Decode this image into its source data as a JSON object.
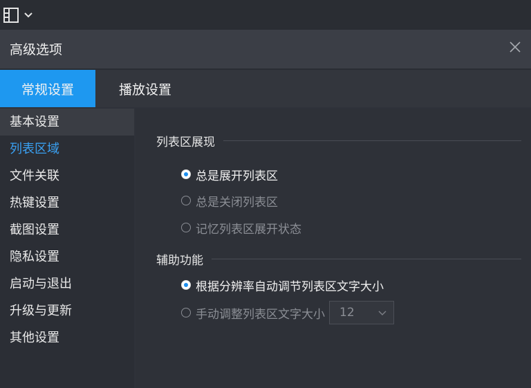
{
  "icons": {
    "menu": "menu-grid-icon",
    "dropdown": "chevron-down-icon",
    "close": "close-icon",
    "select_arrow": "chevron-down-icon"
  },
  "colors": {
    "accent": "#1e98f0",
    "active_sidebar_text": "#3aa1f3",
    "disabled_text": "#8b8e95"
  },
  "dialog": {
    "title": "高级选项",
    "tabs": [
      {
        "label": "常规设置",
        "active": true
      },
      {
        "label": "播放设置",
        "active": false
      }
    ]
  },
  "sidebar": {
    "items": [
      {
        "label": "基本设置"
      },
      {
        "label": "列表区域"
      },
      {
        "label": "文件关联"
      },
      {
        "label": "热键设置"
      },
      {
        "label": "截图设置"
      },
      {
        "label": "隐私设置"
      },
      {
        "label": "启动与退出"
      },
      {
        "label": "升级与更新"
      },
      {
        "label": "其他设置"
      }
    ]
  },
  "content": {
    "list_display": {
      "heading": "列表区展现",
      "options": [
        {
          "label": "总是展开列表区",
          "checked": true
        },
        {
          "label": "总是关闭列表区",
          "checked": false
        },
        {
          "label": "记忆列表区展开状态",
          "checked": false
        }
      ]
    },
    "assist": {
      "heading": "辅助功能",
      "options": [
        {
          "label": "根据分辨率自动调节列表区文字大小",
          "checked": true
        },
        {
          "label": "手动调整列表区文字大小",
          "checked": false
        }
      ],
      "font_size_value": "12"
    }
  }
}
